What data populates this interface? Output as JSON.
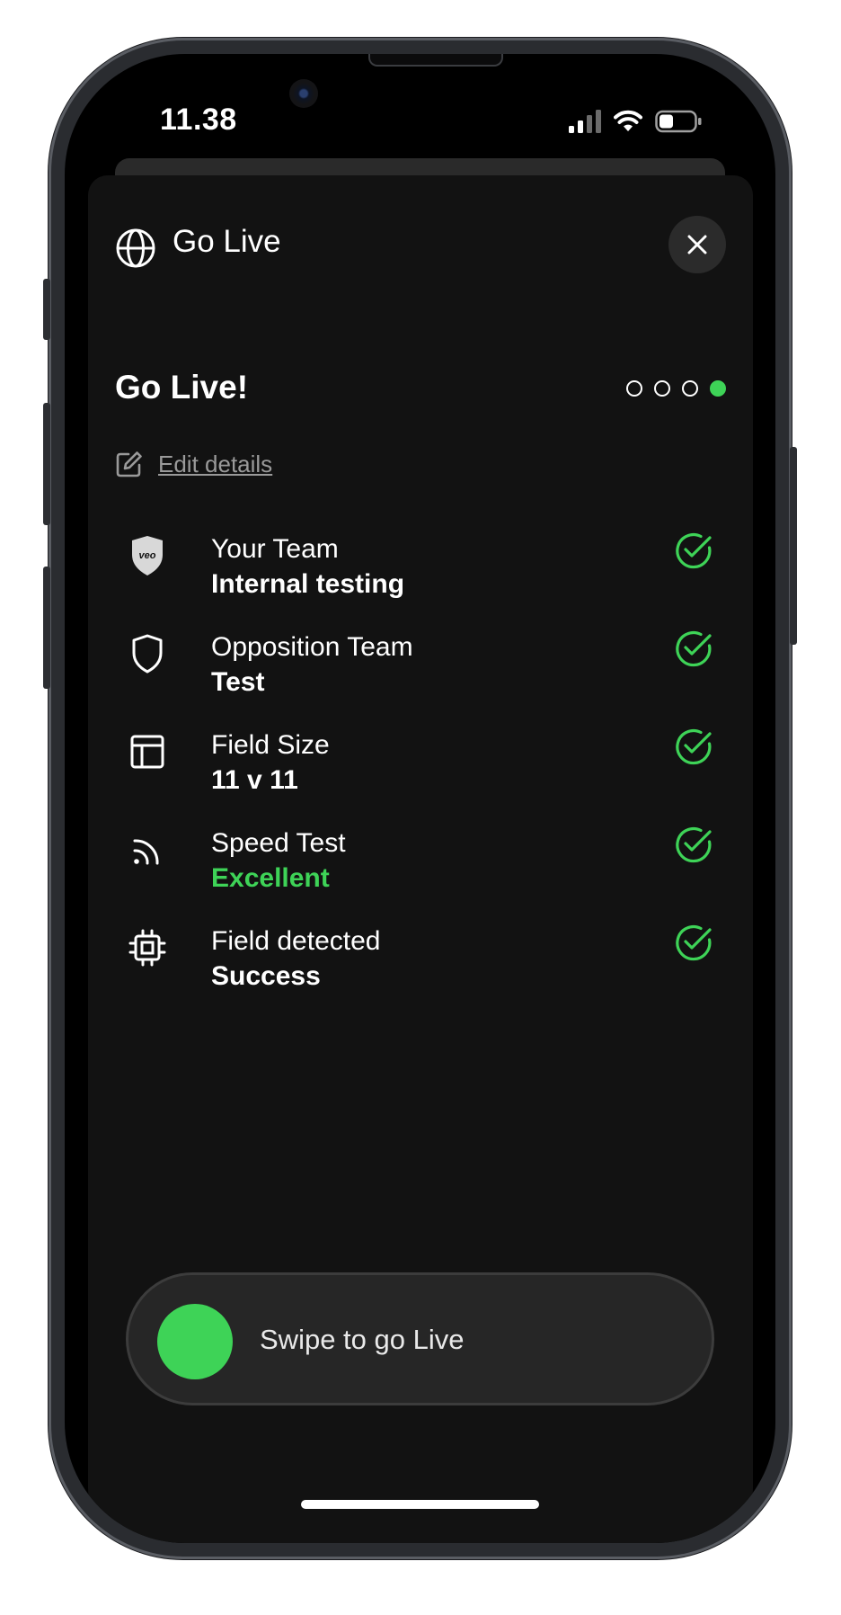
{
  "status_bar": {
    "time": "11.38"
  },
  "header": {
    "title": "Go Live"
  },
  "step": {
    "title": "Go Live!",
    "progress_current": 4,
    "progress_total": 4
  },
  "edit": {
    "label": "Edit details"
  },
  "items": [
    {
      "label": "Your Team",
      "value": "Internal testing",
      "icon": "veo-badge-icon",
      "value_color": "#ffffff"
    },
    {
      "label": "Opposition Team",
      "value": "Test",
      "icon": "shield-icon",
      "value_color": "#ffffff"
    },
    {
      "label": "Field Size",
      "value": "11 v 11",
      "icon": "field-icon",
      "value_color": "#ffffff"
    },
    {
      "label": "Speed Test",
      "value": "Excellent",
      "icon": "signal-icon",
      "value_color": "#3ed357"
    },
    {
      "label": "Field detected",
      "value": "Success",
      "icon": "chip-icon",
      "value_color": "#ffffff"
    }
  ],
  "badge_text": "veo",
  "swipe": {
    "label": "Swipe to go Live"
  },
  "colors": {
    "accent": "#3ed357",
    "sheet": "#121212",
    "background": "#000000"
  }
}
